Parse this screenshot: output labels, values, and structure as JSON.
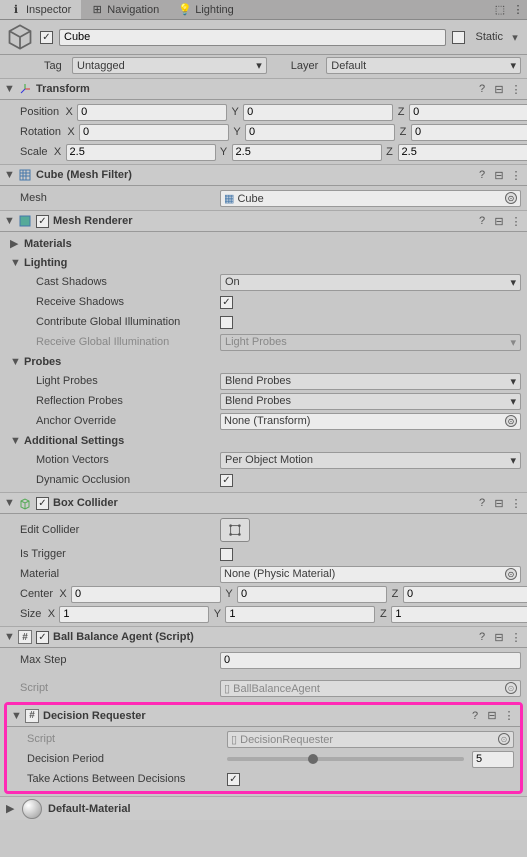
{
  "tabs": {
    "inspector": "Inspector",
    "navigation": "Navigation",
    "lighting": "Lighting"
  },
  "header": {
    "name": "Cube",
    "static": "Static",
    "tag_label": "Tag",
    "tag_value": "Untagged",
    "layer_label": "Layer",
    "layer_value": "Default"
  },
  "transform": {
    "title": "Transform",
    "position": {
      "label": "Position",
      "x": "0",
      "y": "0",
      "z": "0"
    },
    "rotation": {
      "label": "Rotation",
      "x": "0",
      "y": "0",
      "z": "0"
    },
    "scale": {
      "label": "Scale",
      "x": "2.5",
      "y": "2.5",
      "z": "2.5"
    }
  },
  "mesh_filter": {
    "title": "Cube (Mesh Filter)",
    "mesh_label": "Mesh",
    "mesh_value": "Cube"
  },
  "mesh_renderer": {
    "title": "Mesh Renderer",
    "materials": "Materials",
    "lighting": "Lighting",
    "cast_shadows": {
      "label": "Cast Shadows",
      "value": "On"
    },
    "receive_shadows": "Receive Shadows",
    "contribute_gi": "Contribute Global Illumination",
    "receive_gi": {
      "label": "Receive Global Illumination",
      "value": "Light Probes"
    },
    "probes": "Probes",
    "light_probes": {
      "label": "Light Probes",
      "value": "Blend Probes"
    },
    "reflection_probes": {
      "label": "Reflection Probes",
      "value": "Blend Probes"
    },
    "anchor_override": {
      "label": "Anchor Override",
      "value": "None (Transform)"
    },
    "additional": "Additional Settings",
    "motion_vectors": {
      "label": "Motion Vectors",
      "value": "Per Object Motion"
    },
    "dynamic_occlusion": "Dynamic Occlusion"
  },
  "box_collider": {
    "title": "Box Collider",
    "edit_collider": "Edit Collider",
    "is_trigger": "Is Trigger",
    "material": {
      "label": "Material",
      "value": "None (Physic Material)"
    },
    "center": {
      "label": "Center",
      "x": "0",
      "y": "0",
      "z": "0"
    },
    "size": {
      "label": "Size",
      "x": "1",
      "y": "1",
      "z": "1"
    }
  },
  "ball_agent": {
    "title": "Ball Balance Agent (Script)",
    "max_step": {
      "label": "Max Step",
      "value": "0"
    },
    "script": {
      "label": "Script",
      "value": "BallBalanceAgent"
    }
  },
  "decision_requester": {
    "title": "Decision Requester",
    "script": {
      "label": "Script",
      "value": "DecisionRequester"
    },
    "decision_period": {
      "label": "Decision Period",
      "value": "5"
    },
    "take_actions": "Take Actions Between Decisions"
  },
  "material": "Default-Material",
  "axis": {
    "x": "X",
    "y": "Y",
    "z": "Z"
  }
}
